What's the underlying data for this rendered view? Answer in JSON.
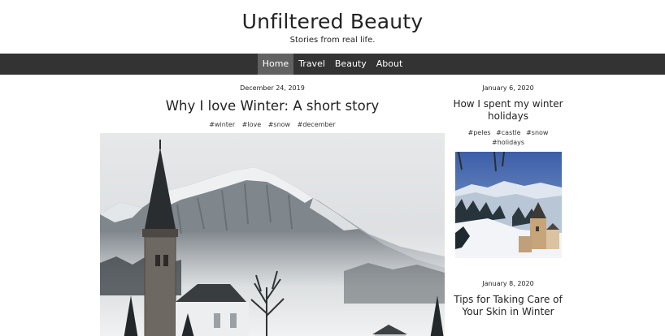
{
  "site": {
    "title": "Unfiltered Beauty",
    "tagline": "Stories from real life."
  },
  "nav": {
    "items": [
      {
        "label": "Home",
        "active": true
      },
      {
        "label": "Travel",
        "active": false
      },
      {
        "label": "Beauty",
        "active": false
      },
      {
        "label": "About",
        "active": false
      }
    ]
  },
  "main_post": {
    "date": "December 24, 2019",
    "title": "Why I love Winter: A short story",
    "tags": [
      "#winter",
      "#love",
      "#snow",
      "#december"
    ],
    "image_icon": "winter-church-photo"
  },
  "side_posts": [
    {
      "date": "January 6, 2020",
      "title": "How I spent my winter holidays",
      "tags": [
        "#peles",
        "#castle",
        "#snow",
        "#holidays"
      ],
      "image_icon": "snowy-castle-photo"
    },
    {
      "date": "January 8, 2020",
      "title": "Tips for Taking Care of Your Skin in Winter"
    }
  ],
  "colors": {
    "navbar_bg": "#333333",
    "nav_active_bg": "#616161",
    "nav_text": "#ffffff",
    "text": "#222222"
  }
}
